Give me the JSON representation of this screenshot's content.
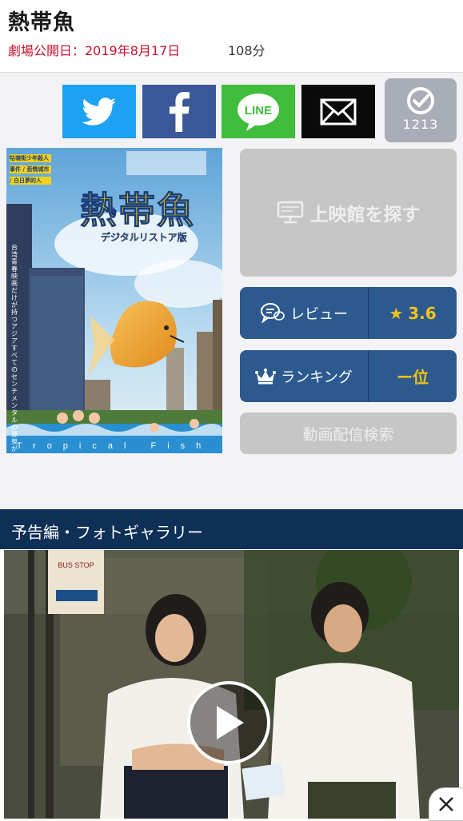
{
  "header": {
    "title": "熱帯魚",
    "release": "劇場公開日：2019年8月17日",
    "runtime": "108分"
  },
  "share": {
    "twitter_icon": "twitter-bird-icon",
    "facebook_icon": "facebook-f-icon",
    "line_label": "LINE",
    "mail_icon": "mail-envelope-icon",
    "check_count": "1213"
  },
  "poster": {
    "title": "熱帯魚",
    "subtitle": "デジタルリストア版",
    "tagline": "台湾青春映画だけが持つアジアすべてのセンチメンタルの源泉がここに",
    "left_credits": "牯嶺街少年殺人事件 / 悲情城市 / 白日夢的人",
    "footer": "Tropical Fish",
    "brand_colors": {
      "sky": "#7bb6dc",
      "title_yellow": "#f3d21a",
      "water": "#2a8fd0"
    }
  },
  "actions": {
    "find_theater": "上映館を探す",
    "review_label": "レビュー",
    "rating": "3.6",
    "ranking_label": "ランキング",
    "ranking_value": "ー位",
    "stream_search": "動画配信検索"
  },
  "gallery": {
    "section_title": "予告編・フォトギャラリー",
    "sign_text": "BUS STOP",
    "play_icon": "play-icon",
    "close_icon": "close-icon"
  },
  "colors": {
    "accent_red": "#c8102e",
    "button_blue": "#2d5a8e",
    "section_navy": "#0e2f56",
    "disabled_gray": "#c6c6c6",
    "star_yellow": "#f3c315"
  }
}
